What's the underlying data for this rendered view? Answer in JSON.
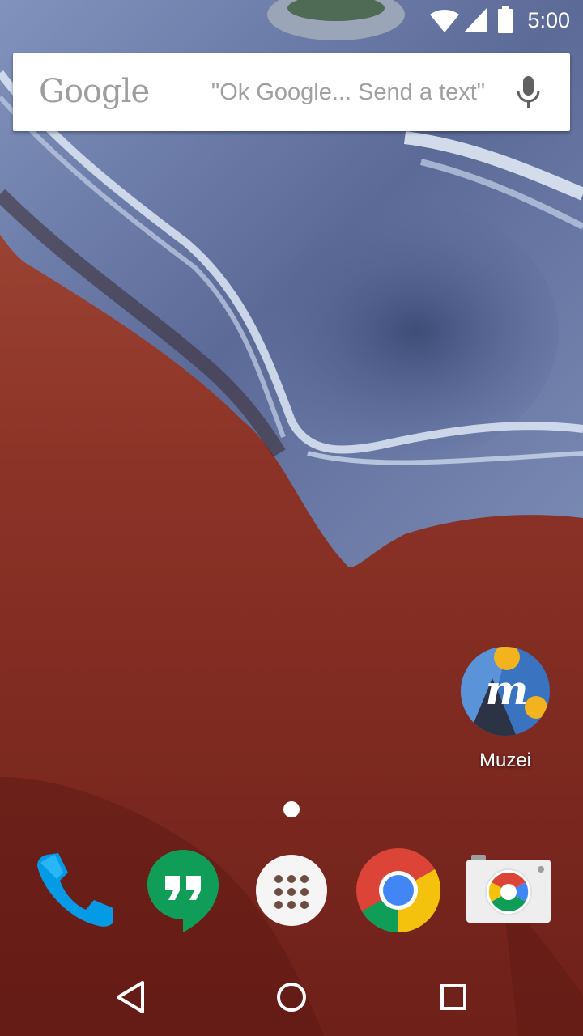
{
  "status_bar": {
    "time": "5:00",
    "icons": [
      "wifi-icon",
      "cellular-signal-icon",
      "battery-icon"
    ]
  },
  "search": {
    "logo_text": "Google",
    "hint": "\"Ok Google... Send a text\"",
    "mic_icon": "microphone-icon"
  },
  "desktop": {
    "shortcuts": [
      {
        "label": "Muzei",
        "icon": "muzei-app-icon"
      }
    ]
  },
  "page_indicator": {
    "pages": 1,
    "current": 1
  },
  "dock": [
    {
      "name": "phone",
      "icon": "phone-app-icon"
    },
    {
      "name": "hangouts",
      "icon": "hangouts-app-icon"
    },
    {
      "name": "app-drawer",
      "icon": "app-drawer-icon"
    },
    {
      "name": "chrome",
      "icon": "chrome-app-icon"
    },
    {
      "name": "camera",
      "icon": "camera-app-icon"
    }
  ],
  "nav": [
    "back-icon",
    "home-icon",
    "recents-icon"
  ],
  "colors": {
    "wallpaper_blue": "#5f6f9c",
    "wallpaper_red": "#8b3126",
    "hangouts_green": "#0f9d58",
    "phone_blue": "#03a9f4",
    "chrome_red": "#db4437",
    "chrome_yellow": "#f4c20d",
    "chrome_green": "#0f9d58",
    "chrome_blue": "#4285f4"
  }
}
